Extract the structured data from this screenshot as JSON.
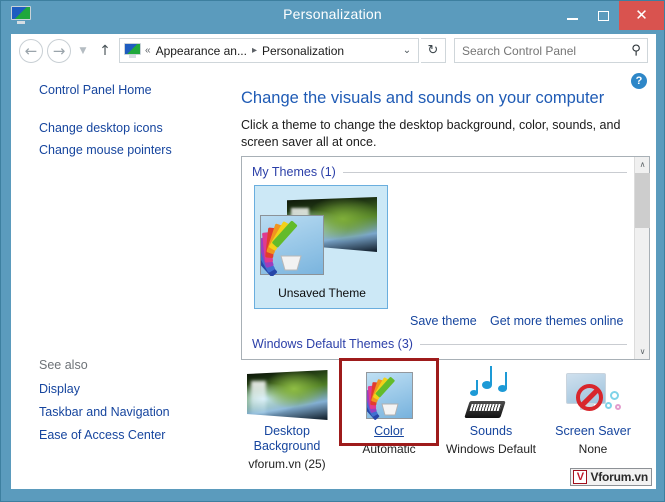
{
  "window": {
    "title": "Personalization",
    "icon": "personalization-monitor-icon",
    "minimize_label": "Minimize",
    "maximize_label": "Maximize",
    "close_label": "Close",
    "titlebar_color": "#5b9bbd",
    "close_button_color": "#d9534f"
  },
  "toolbar": {
    "back_glyph": "←",
    "forward_glyph": "→",
    "recent_glyph": "▼",
    "up_glyph": "↑",
    "address": {
      "icon": "control-panel-monitor-icon",
      "separator_first": "«",
      "crumb_1": "Appearance an...",
      "separator_mid": "▸",
      "crumb_2": "Personalization",
      "dropdown_glyph": "⌄"
    },
    "refresh_glyph": "↻",
    "search": {
      "placeholder": "Search Control Panel",
      "value": "",
      "icon_glyph": "⚲"
    }
  },
  "help": {
    "label": "?"
  },
  "sidebar": {
    "items": [
      {
        "label": "Control Panel Home"
      },
      {
        "label": "Change desktop icons"
      },
      {
        "label": "Change mouse pointers"
      }
    ],
    "see_also_label": "See also",
    "see_also_items": [
      {
        "label": "Display"
      },
      {
        "label": "Taskbar and Navigation"
      },
      {
        "label": "Ease of Access Center"
      }
    ]
  },
  "main": {
    "heading": "Change the visuals and sounds on your computer",
    "subtext": "Click a theme to change the desktop background, color, sounds, and screen saver all at once.",
    "themes_panel": {
      "groups": [
        {
          "label": "My Themes (1)"
        },
        {
          "label": "Windows Default Themes (3)"
        }
      ],
      "theme_tiles": [
        {
          "label": "Unsaved Theme",
          "selected": true
        }
      ],
      "actions": [
        {
          "label": "Save theme"
        },
        {
          "label": "Get more themes online"
        }
      ],
      "scroll_up_glyph": "∧",
      "scroll_down_glyph": "∨"
    },
    "options": [
      {
        "title": "Desktop Background",
        "status": "vforum.vn (25)",
        "icon": "wallpaper-icon",
        "highlighted": false
      },
      {
        "title": "Color",
        "status": "Automatic",
        "icon": "color-palette-icon",
        "highlighted": true,
        "highlight_color": "#9e1b1b"
      },
      {
        "title": "Sounds",
        "status": "Windows Default",
        "icon": "sounds-icon",
        "highlighted": false
      },
      {
        "title": "Screen Saver",
        "status": "None",
        "icon": "screen-saver-icon",
        "highlighted": false
      }
    ]
  },
  "watermark": {
    "mark": "V",
    "text": "Vforum.vn"
  }
}
